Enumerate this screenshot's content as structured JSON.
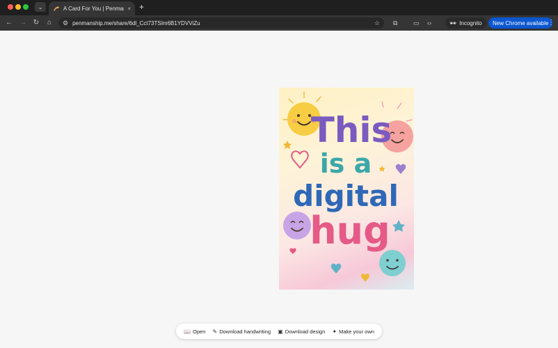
{
  "browser": {
    "tab": {
      "title": "A Card For You | Penmanship",
      "close": "×"
    },
    "new_tab": "+",
    "tab_menu": "⌄",
    "nav": {
      "back": "←",
      "forward": "→",
      "reload": "↻",
      "home": "⌂"
    },
    "url": "penmanship.me/share/6dl_Cct73TSIm6B1YDVViZu",
    "incognito_label": "Incognito",
    "update_label": "New Chrome available"
  },
  "card": {
    "words": [
      "This",
      "is a",
      "digital",
      "hug"
    ],
    "colors": {
      "purple": "#7a5bbf",
      "teal": "#3ba7a9",
      "blue": "#2f68b7",
      "pink": "#e55a86",
      "sun": "#f7cd43",
      "peach": "#f6a2a0",
      "lavender": "#c7a4e6",
      "aqua": "#7fcfd0"
    }
  },
  "actions": [
    {
      "icon": "book-icon",
      "glyph": "📖",
      "label": "Open"
    },
    {
      "icon": "pen-icon",
      "glyph": "✎",
      "label": "Download handwriting"
    },
    {
      "icon": "image-icon",
      "glyph": "▣",
      "label": "Download design"
    },
    {
      "icon": "sparkle-icon",
      "glyph": "✦",
      "label": "Make your own"
    }
  ]
}
